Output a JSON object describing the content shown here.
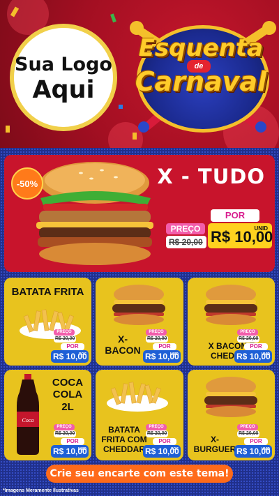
{
  "header": {
    "logo_line1": "Sua Logo",
    "logo_line2": "Aqui",
    "brand_line1": "Esquenta",
    "brand_de": "de",
    "brand_line2": "Carnaval"
  },
  "hero": {
    "title": "X - TUDO",
    "discount": "-50%",
    "preco_label": "PREÇO",
    "old_price": "R$ 20,00",
    "por_label": "POR",
    "new_price": "R$ 10,00",
    "unit": "UNID"
  },
  "products": [
    {
      "name_lines": [
        "BATATA FRITA"
      ],
      "preco_label": "PREÇO",
      "old_price": "R$ 20,00",
      "por_label": "POR",
      "new_price": "R$ 10,00",
      "unit": "POC"
    },
    {
      "name_lines": [
        "X-",
        "BACON"
      ],
      "preco_label": "PREÇO",
      "old_price": "R$ 20,00",
      "por_label": "POR",
      "new_price": "R$ 10,00",
      "unit": "UNID"
    },
    {
      "name_lines": [
        "X BACON E",
        "CHEDDAR"
      ],
      "preco_label": "PREÇO",
      "old_price": "R$ 20,00",
      "por_label": "POR",
      "new_price": "R$ 10,00",
      "unit": "UNID"
    },
    {
      "name_lines": [
        "COCA",
        "COLA",
        "2L"
      ],
      "preco_label": "PREÇO",
      "old_price": "R$ 20,00",
      "por_label": "POR",
      "new_price": "R$ 10,00",
      "unit": "UNID"
    },
    {
      "name_lines": [
        "BATATA",
        "FRITA COM",
        "CHEDDAR"
      ],
      "preco_label": "PREÇO",
      "old_price": "R$ 20,00",
      "por_label": "POR",
      "new_price": "R$ 10,00",
      "unit": "POC"
    },
    {
      "name_lines": [
        "X-",
        "BURGUER"
      ],
      "preco_label": "PREÇO",
      "old_price": "R$ 20,00",
      "por_label": "POR",
      "new_price": "R$ 10,00",
      "unit": "UNID"
    }
  ],
  "cta": {
    "label": "Crie seu encarte com este tema!"
  },
  "footnote": "*Imagens Meramente Ilustrativas",
  "colors": {
    "header_red": "#c4162c",
    "card_yellow": "#e8c31e",
    "price_blue": "#1e5fd6",
    "preco_pink": "#f25dab",
    "cta_orange": "#ff6a1a",
    "background_blue": "#20308c"
  }
}
